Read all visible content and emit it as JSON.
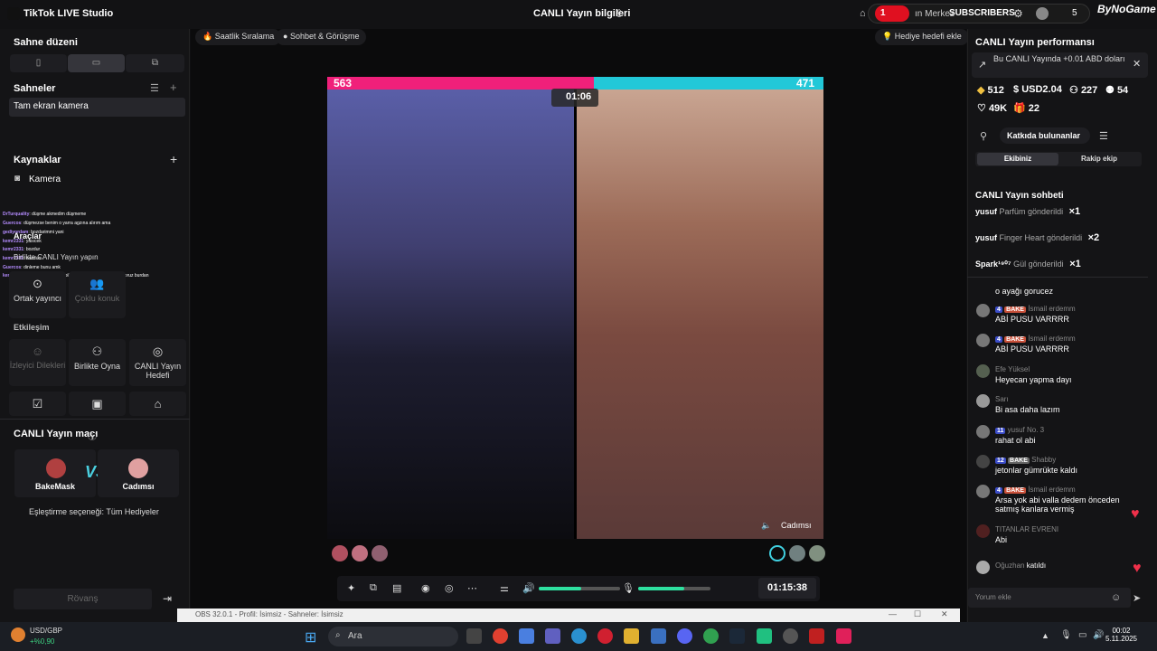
{
  "titlebar": {
    "app_title": "TikTok LIVE Studio",
    "center_title": "CANLI Yayın bilgileri",
    "subscriber_count_red": "1",
    "merkez_text": "ın Merkez",
    "subscribers_label": "SUBSCRIBERS",
    "subscribers_count": "5",
    "brand": "ByNoGame"
  },
  "left_panel": {
    "stage_layout_title": "Sahne düzeni",
    "scenes_title": "Sahneler",
    "scene_item": "Tam ekran kamera",
    "sources_title": "Kaynaklar",
    "source_item": "Kamera",
    "tools_title": "Araçlar",
    "collab_title": "Birlikte CANLI Yayın yapın",
    "collab_cards": [
      "Ortak yayıncı",
      "Çoklu konuk"
    ],
    "interaction_title": "Etkileşim",
    "interaction_cards": [
      "İzleyici Dilekleri",
      "Birlikte Oyna",
      "CANLI Yayın Hedefi"
    ],
    "match_title": "CANLI Yayın maçı",
    "match_left": "BakeMask",
    "match_right": "Cadımsı",
    "match_mode": "Eşleştirme seçeneği: Tüm Hediyeler",
    "rematch": "Rövanş",
    "chat_overlay": [
      {
        "user": "DrTurquality",
        "text": ": düşme akmedim düşmeme"
      },
      {
        "user": "Guercos",
        "text": ": düşmezse benim o yarra agzına alırım ama"
      },
      {
        "user": "gediyordam",
        "text": ": bozdarimmi yani"
      },
      {
        "user": "kemr2331",
        "text": ": yasıcek"
      },
      {
        "user": "kemr2331",
        "text": ": bozdur"
      },
      {
        "user": "kemr2331",
        "text": ": bozdurr"
      },
      {
        "user": "Guercos",
        "text": ": dinleme bunu amk"
      },
      {
        "user": "kemr2331",
        "text": ": hakemin hakiminin bilek kırılmış geçmiş olsun diyoruz burdan"
      }
    ]
  },
  "middle": {
    "pill_hourly": "Saatlik Sıralama",
    "pill_chat": "Sohbet & Görüşme",
    "pill_gift_goal": "Hediye hedefi ekle",
    "score_left": "563",
    "score_right": "471",
    "battle_timer": "01:06",
    "opponent_label": "Cadımsı",
    "live_clock": "01:15:38",
    "obs_bar": "OBS 32.0.1 - Profil: İsimsiz - Sahneler: İsimsiz"
  },
  "right_panel": {
    "perf_title": "CANLI Yayın performansı",
    "perf_note": "Bu CANLI Yayında +0.01 ABD doları",
    "stats": {
      "diamonds": "512",
      "usd": "USD2.04",
      "viewers": "227",
      "new": "54",
      "likes": "49K",
      "gifts": "22"
    },
    "contributors": "Katkıda bulunanlar",
    "tab_team": "Ekibiniz",
    "tab_rival": "Rakip ekip",
    "chat_title": "CANLI Yayın sohbeti",
    "gifts": [
      {
        "user": "yusuf",
        "text": "Parfüm gönderildi",
        "count": "×1"
      },
      {
        "user": "yusuf",
        "text": "Finger Heart gönderildi",
        "count": "×2"
      },
      {
        "user": "Spark¹⁹⁰⁷",
        "text": "Gül gönderildi",
        "count": "×1"
      }
    ],
    "partial_msg": "o ayağı gorucez",
    "messages": [
      {
        "level": "4",
        "fan": "BAKE",
        "user": "İsmail erdemm",
        "text": "ABİ PUSU VARRRR"
      },
      {
        "level": "4",
        "fan": "BAKE",
        "user": "İsmail erdemm",
        "text": "ABİ PUSU VARRRR"
      },
      {
        "level": "",
        "fan": "",
        "user": "Efe Yüksel",
        "text": "Heyecan yapma dayı"
      },
      {
        "level": "",
        "fan": "",
        "user": "Sarı",
        "text": "Bi asa daha lazım"
      },
      {
        "level": "11",
        "fan": "",
        "user": "yusuf  No. 3",
        "text": "rahat ol abi"
      },
      {
        "level": "12",
        "fan": "BAKE",
        "user": "Shabby",
        "text": "jetonlar gümrükte kaldı"
      },
      {
        "level": "4",
        "fan": "BAKE",
        "user": "İsmail erdemm",
        "text": "Arsa yok abi valla dedem önceden satmış kanlara vermiş"
      },
      {
        "level": "",
        "fan": "",
        "user": "TITANLAR EVRENI",
        "text": "Abi"
      },
      {
        "level": "",
        "fan": "",
        "user": "Oğuzhan",
        "text": "katıldı"
      }
    ],
    "comment_placeholder": "Yorum ekle"
  },
  "taskbar": {
    "ticker_name": "USD/GBP",
    "ticker_change": "+%0,90",
    "search": "Ara",
    "time": "00:02",
    "date": "5.11.2025"
  }
}
